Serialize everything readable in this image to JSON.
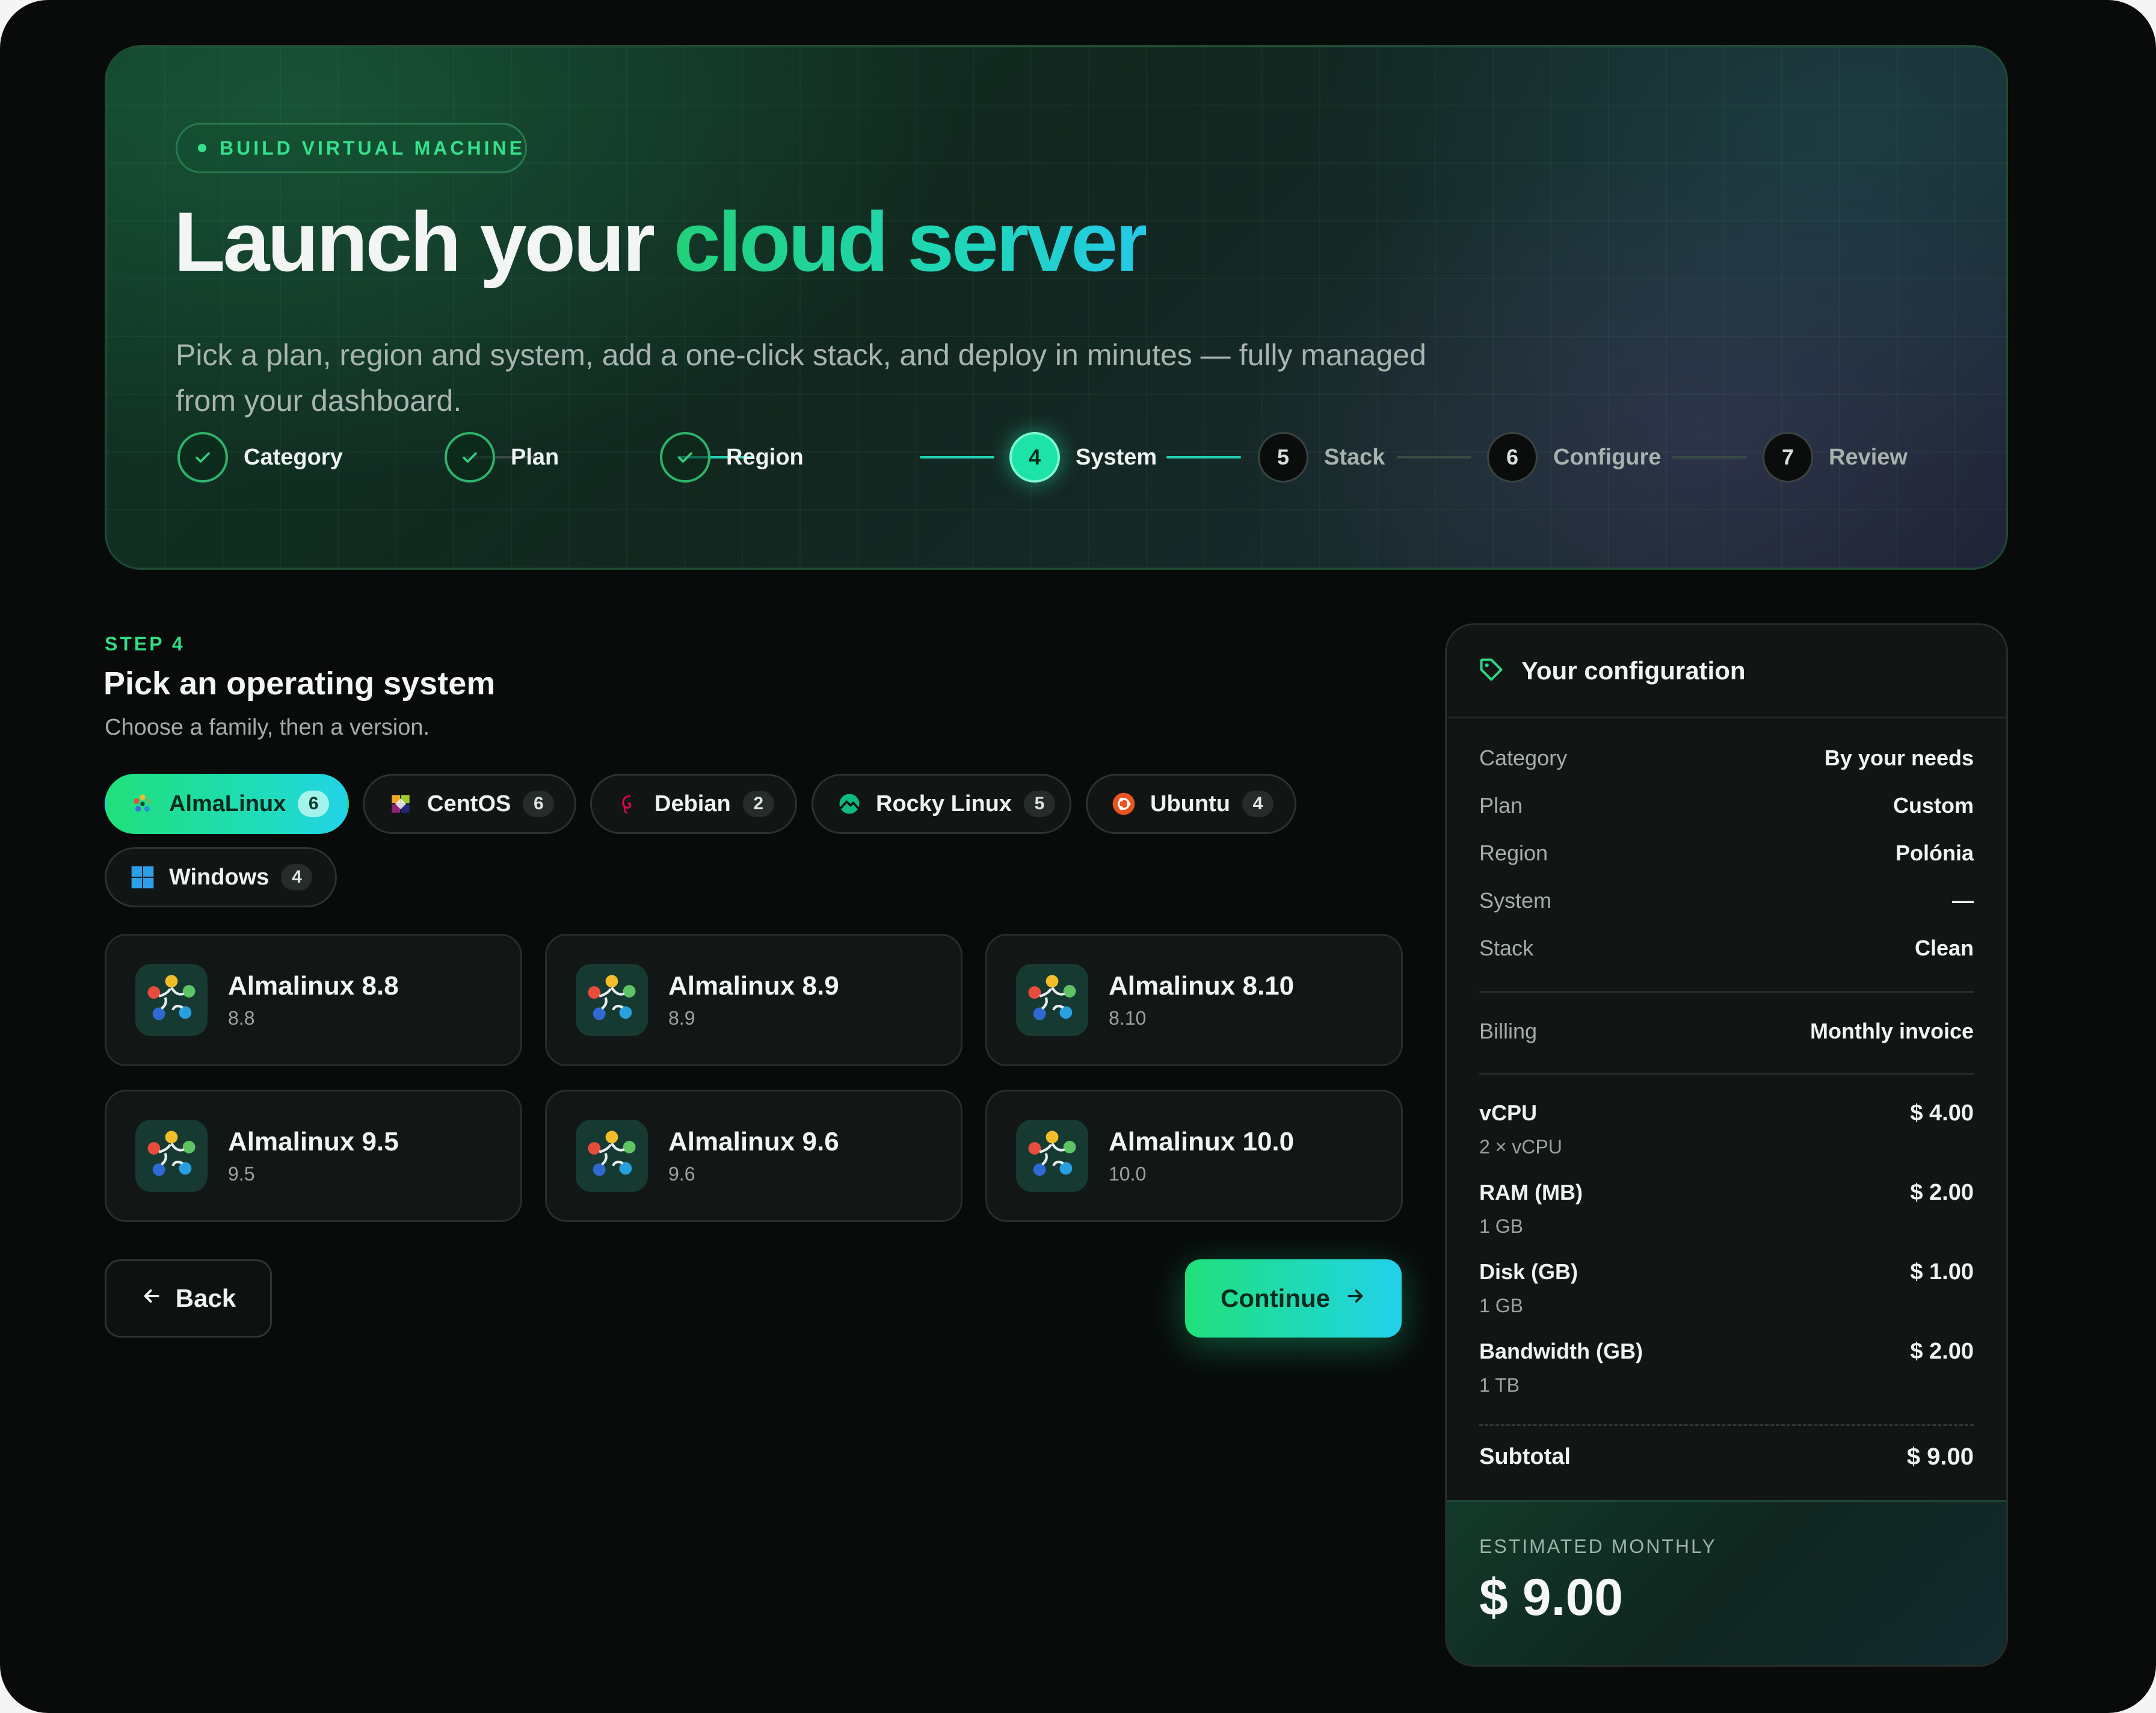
{
  "hero": {
    "badge": "BUILD VIRTUAL MACHINE",
    "title_plain": "Launch your ",
    "title_accent": "cloud server",
    "subtitle": "Pick a plan, region and system, add a one-click stack, and deploy in minutes — fully managed from your dashboard."
  },
  "stepper": [
    {
      "number": "1",
      "label": "Category",
      "state": "done"
    },
    {
      "number": "2",
      "label": "Plan",
      "state": "done"
    },
    {
      "number": "3",
      "label": "Region",
      "state": "done"
    },
    {
      "number": "4",
      "label": "System",
      "state": "active"
    },
    {
      "number": "5",
      "label": "Stack",
      "state": "todo"
    },
    {
      "number": "6",
      "label": "Configure",
      "state": "todo"
    },
    {
      "number": "7",
      "label": "Review",
      "state": "todo"
    }
  ],
  "section": {
    "kicker": "STEP 4",
    "title": "Pick an operating system",
    "subtitle": "Choose a family, then a version."
  },
  "families": [
    {
      "name": "AlmaLinux",
      "count": "6",
      "icon": "almalinux-icon",
      "selected": true
    },
    {
      "name": "CentOS",
      "count": "6",
      "icon": "centos-icon",
      "selected": false
    },
    {
      "name": "Debian",
      "count": "2",
      "icon": "debian-icon",
      "selected": false
    },
    {
      "name": "Rocky Linux",
      "count": "5",
      "icon": "rocky-linux-icon",
      "selected": false
    },
    {
      "name": "Ubuntu",
      "count": "4",
      "icon": "ubuntu-icon",
      "selected": false
    },
    {
      "name": "Windows",
      "count": "4",
      "icon": "windows-icon",
      "selected": false
    }
  ],
  "versions": [
    {
      "name": "Almalinux 8.8",
      "version": "8.8"
    },
    {
      "name": "Almalinux 8.9",
      "version": "8.9"
    },
    {
      "name": "Almalinux 8.10",
      "version": "8.10"
    },
    {
      "name": "Almalinux 9.5",
      "version": "9.5"
    },
    {
      "name": "Almalinux 9.6",
      "version": "9.6"
    },
    {
      "name": "Almalinux 10.0",
      "version": "10.0"
    }
  ],
  "actions": {
    "back": "Back",
    "continue": "Continue"
  },
  "summary": {
    "title": "Your configuration",
    "rows": [
      {
        "key": "Category",
        "value": "By your needs"
      },
      {
        "key": "Plan",
        "value": "Custom"
      },
      {
        "key": "Region",
        "value": "Polónia"
      },
      {
        "key": "System",
        "value": "—"
      },
      {
        "key": "Stack",
        "value": "Clean"
      }
    ],
    "billing": {
      "key": "Billing",
      "value": "Monthly invoice"
    },
    "prices": [
      {
        "name": "vCPU",
        "detail": "2 × vCPU",
        "amount": "$ 4.00"
      },
      {
        "name": "RAM (MB)",
        "detail": "1 GB",
        "amount": "$ 2.00"
      },
      {
        "name": "Disk (GB)",
        "detail": "1 GB",
        "amount": "$ 1.00"
      },
      {
        "name": "Bandwidth (GB)",
        "detail": "1 TB",
        "amount": "$ 2.00"
      }
    ],
    "subtotal": {
      "label": "Subtotal",
      "amount": "$ 9.00"
    },
    "estimate": {
      "label": "ESTIMATED MONTHLY",
      "amount": "$ 9.00"
    }
  },
  "colors": {
    "accent": "#20e07a",
    "accent_cyan": "#23d0ea",
    "background": "#080b0a"
  }
}
